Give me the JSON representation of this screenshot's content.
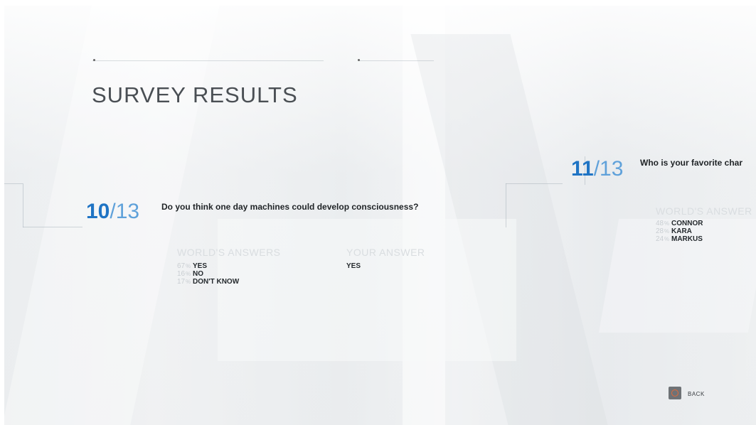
{
  "page": {
    "title": "SURVEY RESULTS"
  },
  "questions": [
    {
      "number": "10",
      "total": "/13",
      "text": "Do you think one day machines could develop consciousness?",
      "worlds_heading": "WORLD'S ANSWERS",
      "your_heading": "YOUR ANSWER",
      "answers": [
        {
          "pct": "67",
          "label": "YES"
        },
        {
          "pct": "16",
          "label": "NO"
        },
        {
          "pct": "17",
          "label": "DON'T KNOW"
        }
      ],
      "your_answer": "YES"
    },
    {
      "number": "11",
      "total": "/13",
      "text": "Who is your favorite char",
      "worlds_heading": "WORLD'S ANSWER",
      "answers": [
        {
          "pct": "48",
          "label": "CONNOR"
        },
        {
          "pct": "28",
          "label": "KARA"
        },
        {
          "pct": "24",
          "label": "MARKUS"
        }
      ]
    }
  ],
  "footer": {
    "back_label": "BACK",
    "back_icon": "circle-button-icon",
    "back_icon_color": "#e06a3a"
  },
  "colors": {
    "accent": "#1f74c4",
    "title": "#4a4f54"
  }
}
